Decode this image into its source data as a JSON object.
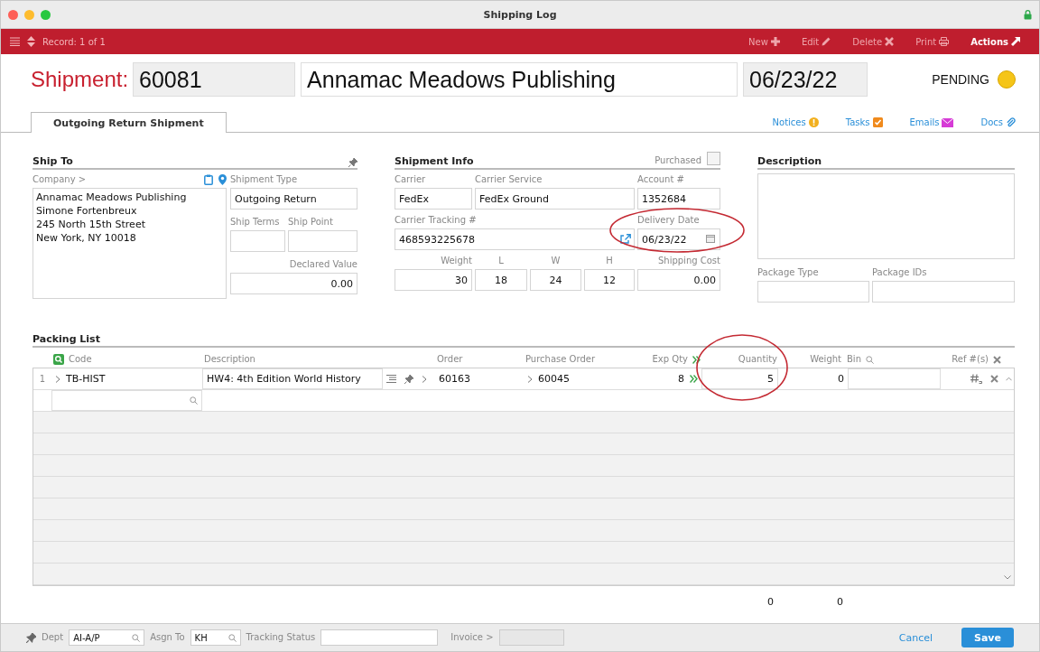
{
  "window": {
    "title": "Shipping Log"
  },
  "toolbar": {
    "record": "Record: 1 of 1",
    "actions": [
      {
        "label": "New",
        "kind": "plus",
        "disabled": true
      },
      {
        "label": "Edit",
        "kind": "pencil",
        "disabled": true
      },
      {
        "label": "Delete",
        "kind": "cross",
        "disabled": true
      },
      {
        "label": "Print",
        "kind": "printer",
        "disabled": true
      },
      {
        "label": "Actions",
        "kind": "arrow",
        "disabled": false
      }
    ]
  },
  "header": {
    "label": "Shipment:",
    "number": "60081",
    "company": "Annamac Meadows Publishing",
    "date": "06/23/22",
    "status": "PENDING"
  },
  "tabs": [
    {
      "label": "Outgoing Return Shipment",
      "selected": true
    }
  ],
  "links": [
    {
      "label": "Notices",
      "kind": "warning"
    },
    {
      "label": "Tasks",
      "kind": "task"
    },
    {
      "label": "Emails",
      "kind": "email"
    },
    {
      "label": "Docs",
      "kind": "attachment"
    }
  ],
  "ship_to": {
    "title": "Ship To",
    "company_label": "Company >",
    "address": [
      "Annamac Meadows Publishing",
      "Simone Fortenbreux",
      "245 North 15th Street",
      "New York, NY 10018"
    ],
    "shipment_type": {
      "label": "Shipment Type",
      "value": "Outgoing Return"
    },
    "ship_terms": {
      "label": "Ship Terms"
    },
    "ship_point": {
      "label": "Ship Point"
    },
    "declared_value": {
      "label": "Declared Value",
      "value": "0.00"
    }
  },
  "shipment_info": {
    "title": "Shipment Info",
    "purchased": {
      "label": "Purchased",
      "checked": false
    },
    "carrier": {
      "label": "Carrier",
      "value": "FedEx"
    },
    "carrier_service": {
      "label": "Carrier Service",
      "value": "FedEx Ground"
    },
    "account": {
      "label": "Account #",
      "value": "1352684"
    },
    "tracking": {
      "label": "Carrier Tracking #",
      "value": "468593225678"
    },
    "delivery_date": {
      "label": "Delivery Date",
      "value": "06/23/22",
      "highlighted": true
    },
    "weight": {
      "label": "Weight",
      "value": "30"
    },
    "length": {
      "label": "L",
      "value": "18"
    },
    "width": {
      "label": "W",
      "value": "24"
    },
    "height": {
      "label": "H",
      "value": "12"
    },
    "shipping_cost": {
      "label": "Shipping Cost",
      "value": "0.00"
    }
  },
  "description": {
    "title": "Description",
    "package_type": {
      "label": "Package Type"
    },
    "package_ids": {
      "label": "Package IDs"
    }
  },
  "packing_list": {
    "title": "Packing List",
    "columns": [
      "Code",
      "Description",
      "Order",
      "Purchase Order",
      "Exp Qty",
      "Quantity",
      "Weight",
      "Bin",
      "Ref #(s)"
    ],
    "quantity_highlighted": true,
    "rows": [
      {
        "number": "1",
        "code": "TB-HIST",
        "description": "HW4: 4th Edition World History",
        "order": "60163",
        "purchase_order": "60045",
        "exp_qty": "8",
        "quantity": "5",
        "weight": "0"
      }
    ],
    "totals": {
      "quantity": "0",
      "weight": "0"
    }
  },
  "footer": {
    "dept": {
      "label": "Dept",
      "value": "AI-A/P"
    },
    "assign_to": {
      "label": "Asgn To",
      "value": "KH"
    },
    "tracking_status": {
      "label": "Tracking Status"
    },
    "invoice": {
      "label": "Invoice >"
    },
    "buttons": [
      {
        "label": "Cancel",
        "kind": "link"
      },
      {
        "label": "Save",
        "kind": "primary"
      }
    ]
  }
}
